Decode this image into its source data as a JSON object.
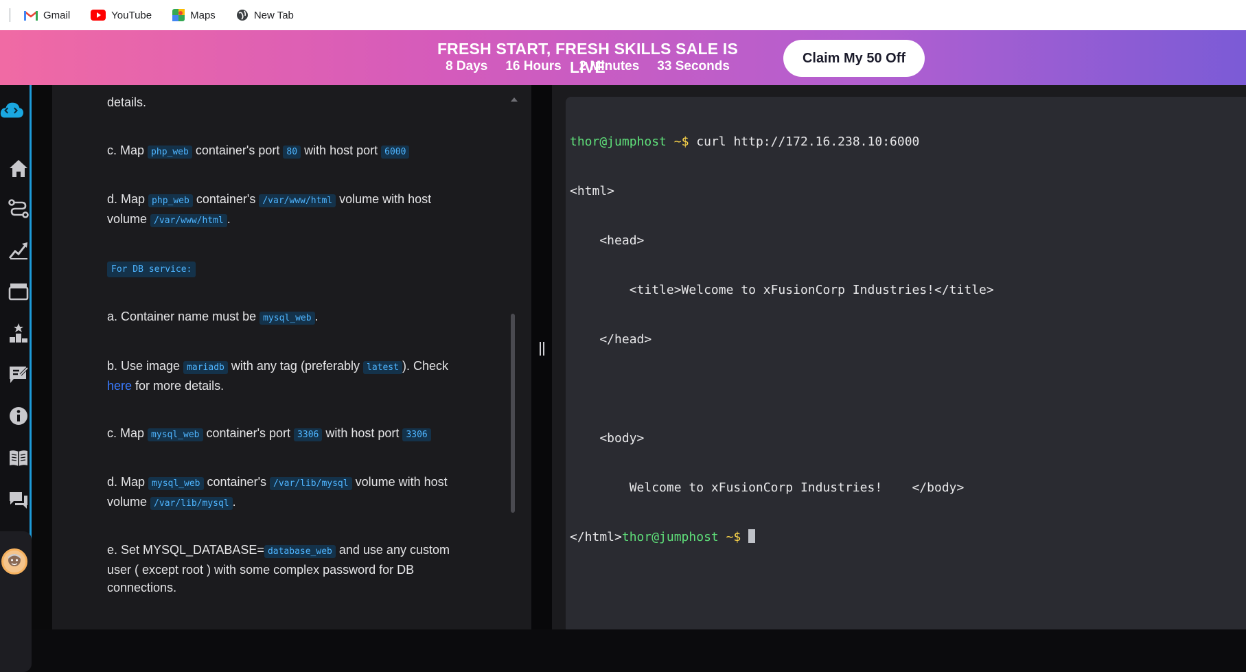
{
  "bookmarks": [
    {
      "label": "Gmail",
      "icon": "gmail-icon"
    },
    {
      "label": "YouTube",
      "icon": "youtube-icon"
    },
    {
      "label": "Maps",
      "icon": "maps-icon"
    },
    {
      "label": "New Tab",
      "icon": "globe-icon"
    }
  ],
  "banner": {
    "title": "FRESH START, FRESH SKILLS SALE IS LIVE",
    "countdown": {
      "days": "8 Days",
      "hours": "16 Hours",
      "minutes": "2 Minutes",
      "seconds": "33 Seconds"
    },
    "cta": "Claim My 50 Off"
  },
  "sidebar": {
    "icons": [
      "logo-icon",
      "home-icon",
      "route-icon",
      "chart-icon",
      "cinema-icon",
      "leaderboard-icon",
      "notes-icon",
      "info-icon",
      "book-icon",
      "chat-icon"
    ],
    "avatar": "avatar"
  },
  "instructions": {
    "details_tail": "details.",
    "web_c": {
      "prefix": "c. Map",
      "c1": "php_web",
      "t1": "container's port",
      "c2": "80",
      "t2": "with host port",
      "c3": "6000"
    },
    "web_d": {
      "prefix": "d. Map",
      "c1": "php_web",
      "t1": "container's",
      "c2": "/var/www/html",
      "t2": "volume with host",
      "t3": "volume",
      "c3": "/var/www/html",
      "end": "."
    },
    "db_header": "For DB service:",
    "db_a": {
      "text": "a. Container name must be",
      "c1": "mysql_web",
      "end": "."
    },
    "db_b": {
      "prefix": "b. Use image",
      "c1": "mariadb",
      "t1": "with any tag (preferably",
      "c2": "latest",
      "t2": "). Check",
      "link": "here",
      "t3": "for more details."
    },
    "db_c": {
      "prefix": "c. Map",
      "c1": "mysql_web",
      "t1": "container's port",
      "c2": "3306",
      "t2": "with host port",
      "c3": "3306"
    },
    "db_d": {
      "prefix": "d. Map",
      "c1": "mysql_web",
      "t1": "container's",
      "c2": "/var/lib/mysql",
      "t2": "volume with host",
      "t3": "volume",
      "c3": "/var/lib/mysql",
      "end": "."
    },
    "db_e": {
      "prefix": "e. Set MYSQL_DATABASE=",
      "c1": "database_web",
      "t1": "and use any custom",
      "line2": "user ( except root ) with some complex password for DB",
      "line3": "connections."
    }
  },
  "terminal": {
    "prompt_user": "thor@jumphost",
    "prompt_sym": "~$",
    "command": "curl http://172.16.238.10:6000",
    "output": [
      "<html>",
      "    <head>",
      "        <title>Welcome to xFusionCorp Industries!</title>",
      "    </head>",
      "",
      "    <body>",
      "        Welcome to xFusionCorp Industries!    </body>"
    ],
    "last_line_prefix": "</html>"
  },
  "colors": {
    "accent": "#1d9bd9",
    "code_fg": "#4fb5ff",
    "prompt_green": "#5fe07a",
    "prompt_yellow": "#ffd84a"
  }
}
